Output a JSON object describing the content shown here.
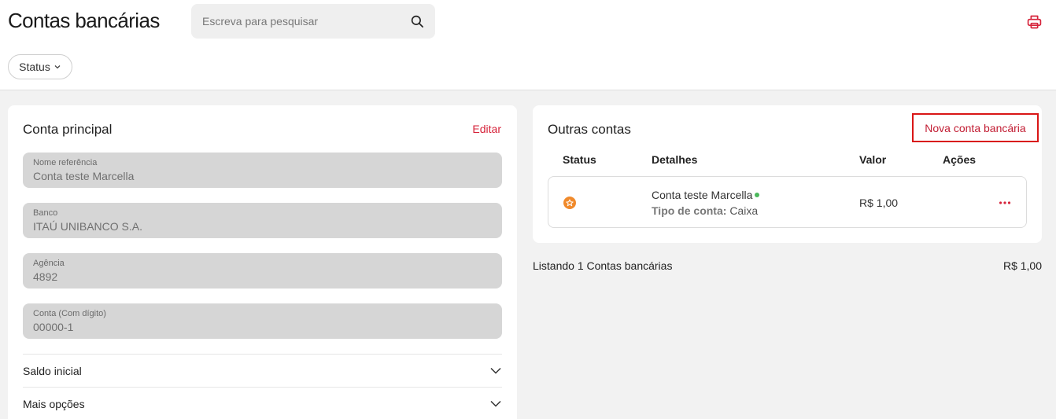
{
  "header": {
    "title": "Contas bancárias",
    "search_placeholder": "Escreva para pesquisar",
    "status_filter_label": "Status"
  },
  "main_account": {
    "title": "Conta principal",
    "edit_label": "Editar",
    "fields": [
      {
        "label": "Nome referência",
        "value": "Conta teste Marcella"
      },
      {
        "label": "Banco",
        "value": "ITAÚ UNIBANCO S.A."
      },
      {
        "label": "Agência",
        "value": "4892"
      },
      {
        "label": "Conta (Com dígito)",
        "value": "00000-1"
      }
    ],
    "accordions": [
      {
        "label": "Saldo inicial"
      },
      {
        "label": "Mais opções"
      }
    ]
  },
  "other_accounts": {
    "title": "Outras contas",
    "new_button_label": "Nova conta bancária",
    "columns": [
      "Status",
      "Detalhes",
      "Valor",
      "Ações"
    ],
    "rows": [
      {
        "name": "Conta teste Marcella",
        "type_label": "Tipo de conta:",
        "type_value": "Caixa",
        "value": "R$ 1,00"
      }
    ]
  },
  "footer": {
    "listing_text": "Listando 1 Contas bancárias",
    "total": "R$ 1,00"
  },
  "colors": {
    "accent_red": "#d6233a",
    "status_orange": "#f08a2c",
    "active_green": "#4cb85c"
  },
  "icons": [
    "search-icon",
    "printer-icon",
    "chevron-down-icon",
    "star-icon",
    "more-horizontal-icon"
  ]
}
